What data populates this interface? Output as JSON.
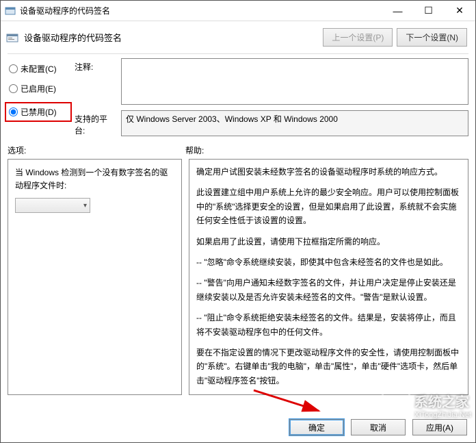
{
  "window": {
    "title": "设备驱动程序的代码签名"
  },
  "header": {
    "title": "设备驱动程序的代码签名",
    "prev_btn": "上一个设置(P)",
    "next_btn": "下一个设置(N)"
  },
  "radios": {
    "not_configured": "未配置(C)",
    "enabled": "已启用(E)",
    "disabled": "已禁用(D)",
    "selected": "disabled"
  },
  "fields": {
    "comment_label": "注释:",
    "comment_value": "",
    "platform_label": "支持的平台:",
    "platform_value": "仅 Windows Server 2003、Windows XP 和 Windows 2000"
  },
  "sections": {
    "options_label": "选项:",
    "help_label": "帮助:"
  },
  "options": {
    "text": "当 Windows 检测到一个没有数字签名的驱动程序文件时:",
    "dropdown_value": ""
  },
  "help": {
    "p1": "确定用户试图安装未经数字签名的设备驱动程序时系统的响应方式。",
    "p2": "此设置建立组中用户系统上允许的最少安全响应。用户可以使用控制面板中的\"系统\"选择更安全的设置，但是如果启用了此设置，系统就不会实施任何安全性低于该设置的设置。",
    "p3": "如果启用了此设置，请使用下拉框指定所需的响应。",
    "p4": "-- \"忽略\"命令系统继续安装，即使其中包含未经签名的文件也是如此。",
    "p5": "-- \"警告\"向用户通知未经数字签名的文件，并让用户决定是停止安装还是继续安装以及是否允许安装未经签名的文件。\"警告\"是默认设置。",
    "p6": "-- \"阻止\"命令系统拒绝安装未经签名的文件。结果是，安装将停止，而且将不安装驱动程序包中的任何文件。",
    "p7": "要在不指定设置的情况下更改驱动程序文件的安全性，请使用控制面板中的\"系统\"。右键单击\"我的电脑\"，单击\"属性\"，单击\"硬件\"选项卡，然后单击\"驱动程序签名\"按钮。"
  },
  "footer": {
    "ok": "确定",
    "cancel": "取消",
    "apply": "应用(A)"
  },
  "watermark": {
    "text": "系统之家",
    "url": "XiTongZhiJia.Net"
  }
}
